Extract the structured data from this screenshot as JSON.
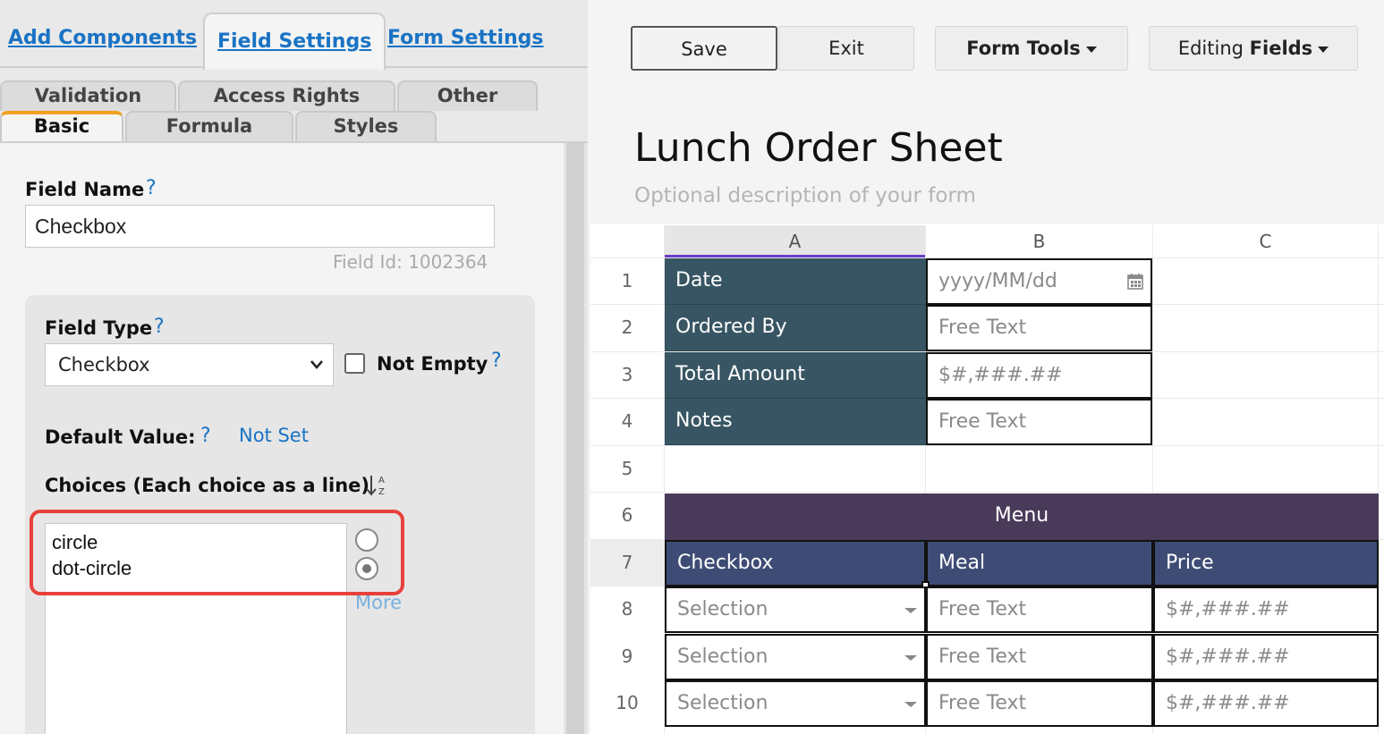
{
  "left_panel": {
    "top_tabs": [
      "Add Components",
      "Field Settings",
      "Form Settings"
    ],
    "sub_tabs_row1": [
      "Validation",
      "Access Rights",
      "Other"
    ],
    "sub_tabs_row2": [
      "Basic",
      "Formula",
      "Styles"
    ],
    "field_name_label": "Field Name",
    "help_mark": "?",
    "field_name_value": "Checkbox",
    "field_id": "Field Id: 1002364",
    "field_type_label": "Field Type",
    "field_type_value": "Checkbox",
    "not_empty_label": "Not Empty",
    "not_empty_checked": false,
    "default_value_label": "Default Value:",
    "default_value": "Not Set",
    "choices_label": "Choices (Each choice as a line)",
    "choices": [
      "circle",
      "dot-circle"
    ],
    "more_link": "More",
    "highlight_color": "#e8413c",
    "link_color": "#1a73c4"
  },
  "toolbar": {
    "save": "Save",
    "exit": "Exit",
    "form_tools": "Form Tools",
    "editing_prefix": "Editing",
    "editing_mode": "Fields"
  },
  "form": {
    "title": "Lunch Order Sheet",
    "description": "Optional description of your form",
    "columns": [
      "A",
      "B",
      "C"
    ],
    "rows": [
      "1",
      "2",
      "3",
      "4",
      "5",
      "6",
      "7",
      "8",
      "9",
      "10"
    ],
    "info_rows": [
      {
        "label": "Date",
        "placeholder": "yyyy/MM/dd"
      },
      {
        "label": "Ordered By",
        "placeholder": "Free Text"
      },
      {
        "label": "Total Amount",
        "placeholder": "$#,###.##"
      },
      {
        "label": "Notes",
        "placeholder": "Free Text"
      }
    ],
    "menu_title": "Menu",
    "table_headers": [
      "Checkbox",
      "Meal",
      "Price"
    ],
    "table_rows": [
      [
        "Selection",
        "Free Text",
        "$#,###.##"
      ],
      [
        "Selection",
        "Free Text",
        "$#,###.##"
      ],
      [
        "Selection",
        "Free Text",
        "$#,###.##"
      ]
    ],
    "colors": {
      "info_label_bg": "#385563",
      "menu_bg": "#4a3a5a",
      "header_bg": "#3e4c75"
    }
  }
}
